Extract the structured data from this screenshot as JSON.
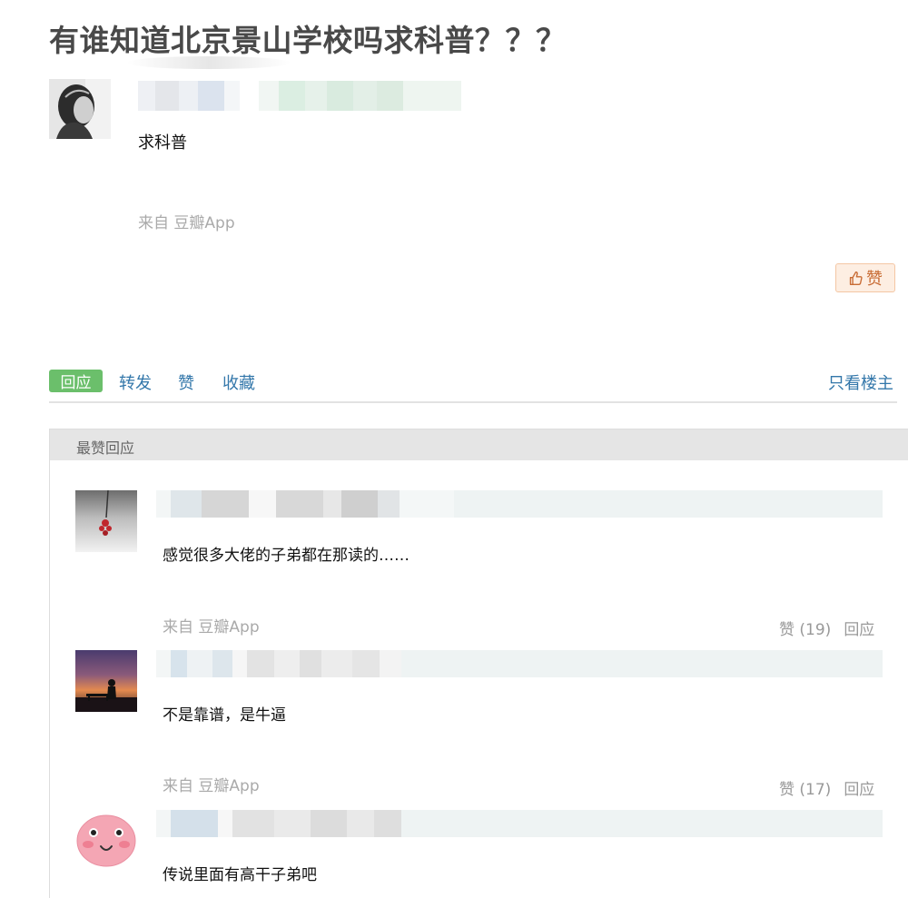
{
  "post": {
    "title": "有谁知道北京景山学校吗求科普？？？",
    "content": "求科普",
    "source": "来自 豆瓣App",
    "like_label": "赞"
  },
  "actions": {
    "reply": "回应",
    "forward": "转发",
    "like": "赞",
    "collect": "收藏",
    "only_op": "只看楼主"
  },
  "top_replies": {
    "header": "最赞回应",
    "comments": [
      {
        "text": "感觉很多大佬的子弟都在那读的……",
        "source": "来自 豆瓣App",
        "likes": "赞 (19)",
        "reply": "回应"
      },
      {
        "text": "不是靠谱，是牛逼",
        "source": "来自 豆瓣App",
        "likes": "赞 (17)",
        "reply": "回应"
      },
      {
        "text": "传说里面有高干子弟吧"
      }
    ]
  },
  "colors": {
    "link": "#3377aa",
    "reply_badge": "#6bbf6b",
    "like_button_bg": "#fdeee2",
    "like_button_text": "#c86b33"
  }
}
